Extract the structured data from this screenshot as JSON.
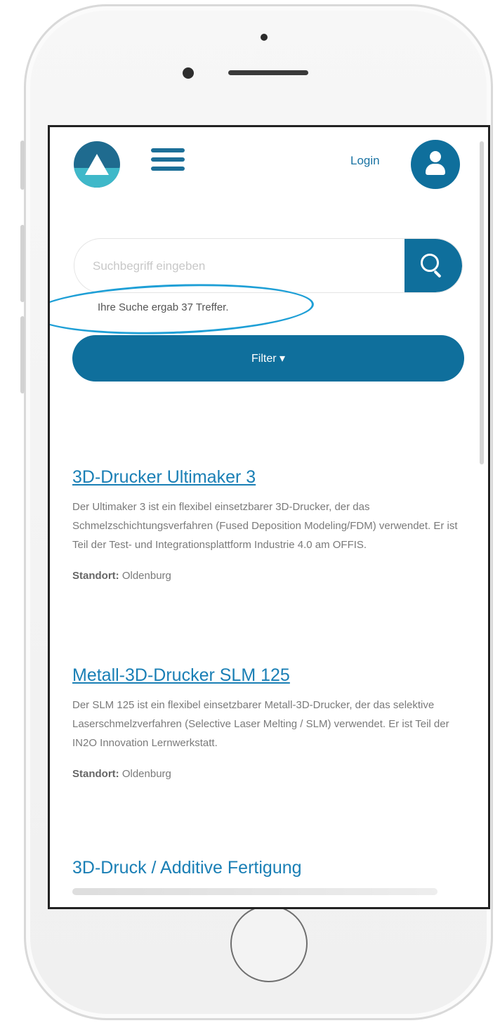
{
  "header": {
    "login_label": "Login"
  },
  "search": {
    "placeholder": "Suchbegriff eingeben",
    "results_text": "Ihre Suche ergab 37 Treffer."
  },
  "filter": {
    "label": "Filter ▾"
  },
  "results": [
    {
      "title": "3D-Drucker Ultimaker 3",
      "description": "Der Ultimaker 3 ist ein flexibel einsetzbarer 3D-Drucker, der das Schmelzschichtungsverfahren (Fused Deposition Modeling/FDM) verwendet. Er ist Teil der Test- und Integrationsplattform Industrie 4.0 am OFFIS.",
      "location_label": "Standort:",
      "location_value": "Oldenburg"
    },
    {
      "title": "Metall-3D-Drucker SLM 125",
      "description": "Der SLM 125 ist ein flexibel einsetzbarer Metall-3D-Drucker, der das selektive Laserschmelzverfahren (Selective Laser Melting / SLM) verwendet. Er ist Teil der IN2O Innovation Lernwerkstatt.",
      "location_label": "Standort:",
      "location_value": "Oldenburg"
    },
    {
      "title": "3D-Druck / Additive Fertigung"
    }
  ],
  "colors": {
    "primary": "#0f6f9c",
    "link": "#1a7fb5",
    "highlight": "#1e9fd6"
  }
}
